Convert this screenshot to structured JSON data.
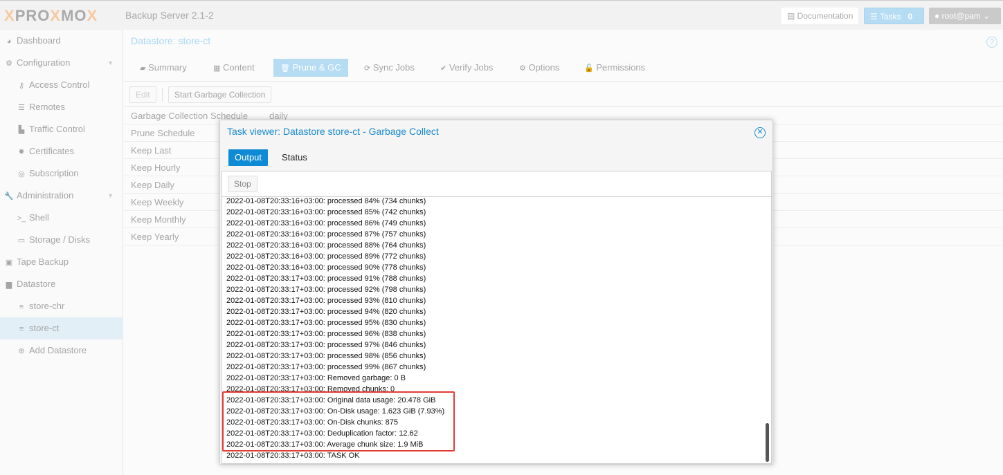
{
  "header": {
    "logo": "PROXMOX",
    "product": "Backup Server 2.1-2",
    "documentation": "Documentation",
    "tasks_label": "Tasks",
    "tasks_count": "0",
    "user": "root@pam"
  },
  "sidebar": [
    {
      "label": "Dashboard",
      "icon": "dashboard-icon",
      "level": 0
    },
    {
      "label": "Configuration",
      "icon": "gears-icon",
      "level": 0,
      "expandable": true
    },
    {
      "label": "Access Control",
      "icon": "key-icon",
      "level": 1
    },
    {
      "label": "Remotes",
      "icon": "server-icon",
      "level": 1
    },
    {
      "label": "Traffic Control",
      "icon": "chart-icon",
      "level": 1
    },
    {
      "label": "Certificates",
      "icon": "certificate-icon",
      "level": 1
    },
    {
      "label": "Subscription",
      "icon": "support-icon",
      "level": 1
    },
    {
      "label": "Administration",
      "icon": "wrench-icon",
      "level": 0,
      "expandable": true
    },
    {
      "label": "Shell",
      "icon": "terminal-icon",
      "level": 1
    },
    {
      "label": "Storage / Disks",
      "icon": "hdd-icon",
      "level": 1
    },
    {
      "label": "Tape Backup",
      "icon": "tape-icon",
      "level": 0
    },
    {
      "label": "Datastore",
      "icon": "archive-icon",
      "level": 0
    },
    {
      "label": "store-chr",
      "icon": "database-icon",
      "level": 1
    },
    {
      "label": "store-ct",
      "icon": "database-icon",
      "level": 1,
      "selected": true
    },
    {
      "label": "Add Datastore",
      "icon": "plus-circle-icon",
      "level": 1
    }
  ],
  "main": {
    "title": "Datastore: store-ct",
    "tabs": [
      "Summary",
      "Content",
      "Prune & GC",
      "Sync Jobs",
      "Verify Jobs",
      "Options",
      "Permissions"
    ],
    "active_tab": "Prune & GC",
    "edit": "Edit",
    "start_gc": "Start Garbage Collection",
    "rows": [
      {
        "k": "Garbage Collection Schedule",
        "v": "daily"
      },
      {
        "k": "Prune Schedule",
        "v": ""
      },
      {
        "k": "Keep Last",
        "v": ""
      },
      {
        "k": "Keep Hourly",
        "v": ""
      },
      {
        "k": "Keep Daily",
        "v": ""
      },
      {
        "k": "Keep Weekly",
        "v": ""
      },
      {
        "k": "Keep Monthly",
        "v": ""
      },
      {
        "k": "Keep Yearly",
        "v": ""
      }
    ]
  },
  "modal": {
    "title": "Task viewer: Datastore store-ct - Garbage Collect",
    "tabs": [
      "Output",
      "Status"
    ],
    "stop": "Stop",
    "log": [
      "2022-01-08T20:33:16+03:00: processed 84% (734 chunks)",
      "2022-01-08T20:33:16+03:00: processed 85% (742 chunks)",
      "2022-01-08T20:33:16+03:00: processed 86% (749 chunks)",
      "2022-01-08T20:33:16+03:00: processed 87% (757 chunks)",
      "2022-01-08T20:33:16+03:00: processed 88% (764 chunks)",
      "2022-01-08T20:33:16+03:00: processed 89% (772 chunks)",
      "2022-01-08T20:33:16+03:00: processed 90% (778 chunks)",
      "2022-01-08T20:33:17+03:00: processed 91% (788 chunks)",
      "2022-01-08T20:33:17+03:00: processed 92% (798 chunks)",
      "2022-01-08T20:33:17+03:00: processed 93% (810 chunks)",
      "2022-01-08T20:33:17+03:00: processed 94% (820 chunks)",
      "2022-01-08T20:33:17+03:00: processed 95% (830 chunks)",
      "2022-01-08T20:33:17+03:00: processed 96% (838 chunks)",
      "2022-01-08T20:33:17+03:00: processed 97% (846 chunks)",
      "2022-01-08T20:33:17+03:00: processed 98% (856 chunks)",
      "2022-01-08T20:33:17+03:00: processed 99% (867 chunks)",
      "2022-01-08T20:33:17+03:00: Removed garbage: 0 B",
      "2022-01-08T20:33:17+03:00: Removed chunks: 0",
      "2022-01-08T20:33:17+03:00: Original data usage: 20.478 GiB",
      "2022-01-08T20:33:17+03:00: On-Disk usage: 1.623 GiB (7.93%)",
      "2022-01-08T20:33:17+03:00: On-Disk chunks: 875",
      "2022-01-08T20:33:17+03:00: Deduplication factor: 12.62",
      "2022-01-08T20:33:17+03:00: Average chunk size: 1.9 MiB",
      "2022-01-08T20:33:17+03:00: TASK OK"
    ]
  },
  "colors": {
    "accent": "#0f8ad5",
    "highlight": "#e53935"
  }
}
